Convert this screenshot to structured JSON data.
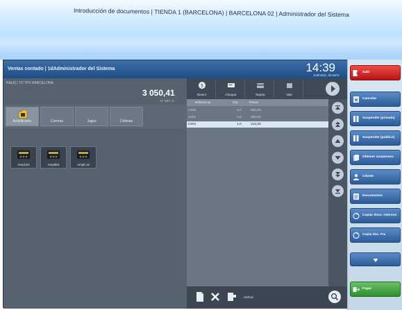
{
  "window": {
    "title": "Introducción de documentos | TIENDA 1 (BARCELONA) | BARCELONA 02 | Administrador del Sistema"
  },
  "header": {
    "title": "Ventas contado | 1dAdministrador del Sistema",
    "time": "14:39",
    "date": "JUEVES, 30 MAY"
  },
  "summary": {
    "store_line": "RAUS | TO TPV BARCELONA",
    "total": "3 050,41",
    "articles": "N° ART.: 5"
  },
  "families": [
    {
      "label": "Amplificador",
      "selected": true,
      "icon": "amplifier-folder-icon"
    },
    {
      "label": "Correos",
      "selected": false
    },
    {
      "label": "Jugos",
      "selected": false
    },
    {
      "label": "Cribinas",
      "selected": false
    }
  ],
  "products": [
    {
      "label": "Ampl.E4",
      "icon": "amplifier-icon"
    },
    {
      "label": "AmpliE5",
      "icon": "amplifier-icon"
    },
    {
      "label": "Ampli.12",
      "icon": "amplifier-icon"
    }
  ],
  "payment_methods": [
    {
      "label": "Dinero",
      "icon": "cash-icon"
    },
    {
      "label": "Cheque",
      "icon": "cheque-icon"
    },
    {
      "label": "Tarjeta",
      "icon": "card-icon"
    },
    {
      "label": "Vale",
      "icon": "voucher-icon"
    }
  ],
  "lines_table": {
    "headers": [
      "Referencia",
      "Cta",
      "Precio"
    ],
    "rows": [
      {
        "ref": "C002",
        "qty": "2,0",
        "price": "830,00",
        "selected": false
      },
      {
        "ref": "A001",
        "qty": "3,0",
        "price": "900,00",
        "selected": false
      },
      {
        "ref": "C001",
        "qty": "1,0",
        "price": "215,00",
        "selected": true
      }
    ]
  },
  "bottom_tools": {
    "label": "SelCal"
  },
  "actions": [
    {
      "label": "Salir",
      "color": "red"
    },
    {
      "label": "Cancelar"
    },
    {
      "label": "Suspender (privado)"
    },
    {
      "label": "Suspender (público)"
    },
    {
      "label": "Obtener suspensos"
    },
    {
      "label": "Cliente"
    },
    {
      "label": "Documentos"
    },
    {
      "label": "Copiar docs. internos"
    },
    {
      "label": "Copia doc. Fra"
    },
    {
      "label": "Pagar",
      "color": "green"
    }
  ],
  "colors": {
    "accent": "#2d5c98",
    "exit": "#c41a1a",
    "pay": "#2f8f2d",
    "panel": "#4d5966"
  }
}
